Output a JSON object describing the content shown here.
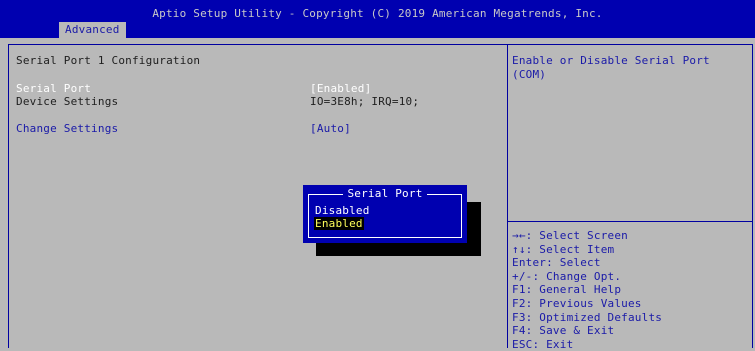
{
  "header": {
    "title": "Aptio Setup Utility - Copyright (C) 2019 American Megatrends, Inc.",
    "active_tab": "Advanced"
  },
  "main": {
    "section_title": "Serial Port 1 Configuration",
    "rows": [
      {
        "label": "Serial Port",
        "value": "[Enabled]"
      },
      {
        "label": "Device Settings",
        "value": "IO=3E8h; IRQ=10;"
      },
      {
        "label": "Change Settings",
        "value": "[Auto]"
      }
    ]
  },
  "help": {
    "text": "Enable or Disable Serial Port (COM)"
  },
  "keys": [
    "→←: Select Screen",
    "↑↓: Select Item",
    "Enter: Select",
    "+/-: Change Opt.",
    "F1: General Help",
    "F2: Previous Values",
    "F3: Optimized Defaults",
    "F4: Save & Exit",
    "ESC: Exit"
  ],
  "popup": {
    "title": "Serial Port",
    "options": [
      "Disabled",
      "Enabled"
    ],
    "selected": "Enabled"
  },
  "colors": {
    "header_bg": "#0000b0",
    "body_bg": "#b9b9b9",
    "highlight_fg": "#ffff5a",
    "link_blue": "#1a1aa8"
  }
}
